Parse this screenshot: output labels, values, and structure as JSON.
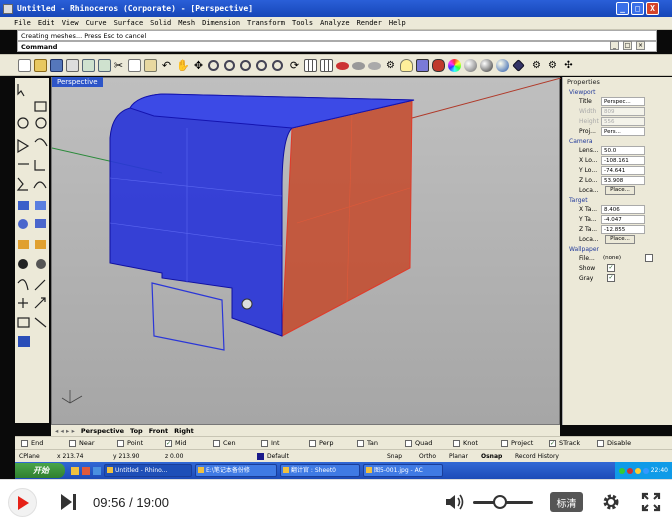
{
  "window": {
    "title": "Untitled - Rhinoceros (Corporate) - [Perspective]",
    "controls": [
      "_",
      "□",
      "X"
    ]
  },
  "menu": [
    "File",
    "Edit",
    "View",
    "Curve",
    "Surface",
    "Solid",
    "Mesh",
    "Dimension",
    "Transform",
    "Tools",
    "Analyze",
    "Render",
    "Help"
  ],
  "command": {
    "history": "Creating meshes... Press Esc to cancel",
    "prompt": "Command"
  },
  "viewport": {
    "label": "Perspective"
  },
  "properties": {
    "header": "Properties",
    "viewport": {
      "title": "Viewport",
      "rows": [
        {
          "label": "Title",
          "value": "Perspec...",
          "disabled": false
        },
        {
          "label": "Width",
          "value": "809",
          "disabled": true
        },
        {
          "label": "Height",
          "value": "556",
          "disabled": true
        },
        {
          "label": "Proj...",
          "value": "Pers...",
          "disabled": false
        }
      ]
    },
    "camera": {
      "title": "Camera",
      "rows": [
        {
          "label": "Lens...",
          "value": "50.0"
        },
        {
          "label": "X Lo...",
          "value": "-108.161"
        },
        {
          "label": "Y Lo...",
          "value": "-74.641"
        },
        {
          "label": "Z Lo...",
          "value": "53.908"
        }
      ],
      "place_label": "Loca...",
      "place_button": "Place..."
    },
    "target": {
      "title": "Target",
      "rows": [
        {
          "label": "X Ta...",
          "value": "8.406"
        },
        {
          "label": "Y Ta...",
          "value": "-4.047"
        },
        {
          "label": "Z Ta...",
          "value": "-12.855"
        }
      ],
      "place_label": "Loca...",
      "place_button": "Place..."
    },
    "wallpaper": {
      "title": "Wallpaper",
      "file_label": "File...",
      "file_value": "(none)",
      "show_label": "Show",
      "gray_label": "Gray"
    }
  },
  "sheet_tabs": [
    "Perspective",
    "Top",
    "Front",
    "Right"
  ],
  "snaps": [
    "End",
    "Near",
    "Point",
    "Mid",
    "Cen",
    "Int",
    "Perp",
    "Tan",
    "Quad",
    "Knot",
    "Project",
    "STrack",
    "Disable"
  ],
  "status": {
    "cplane": "CPlane",
    "x": "x 213.74",
    "y": "y 213.90",
    "z": "z 0.00",
    "layer": "Default",
    "toggles": [
      "Snap",
      "Ortho",
      "Planar",
      "Osnap",
      "Record History"
    ]
  },
  "taskbar": {
    "start": "开始",
    "tasks": [
      "Untitled - Rhino...",
      "E:\\笔记本备份修",
      "翻计官 : Sheet0",
      "图5-001.jpg - AC"
    ],
    "clock": "22:40"
  },
  "player": {
    "current_time": "09:56",
    "separator": "/",
    "duration": "19:00",
    "quality": "标清",
    "volume": 0.45
  },
  "colors": {
    "accent": "#e62117",
    "rhino_blue": "#2d55c8",
    "object_blue": "#2a36d8",
    "object_red": "#c4492a"
  }
}
